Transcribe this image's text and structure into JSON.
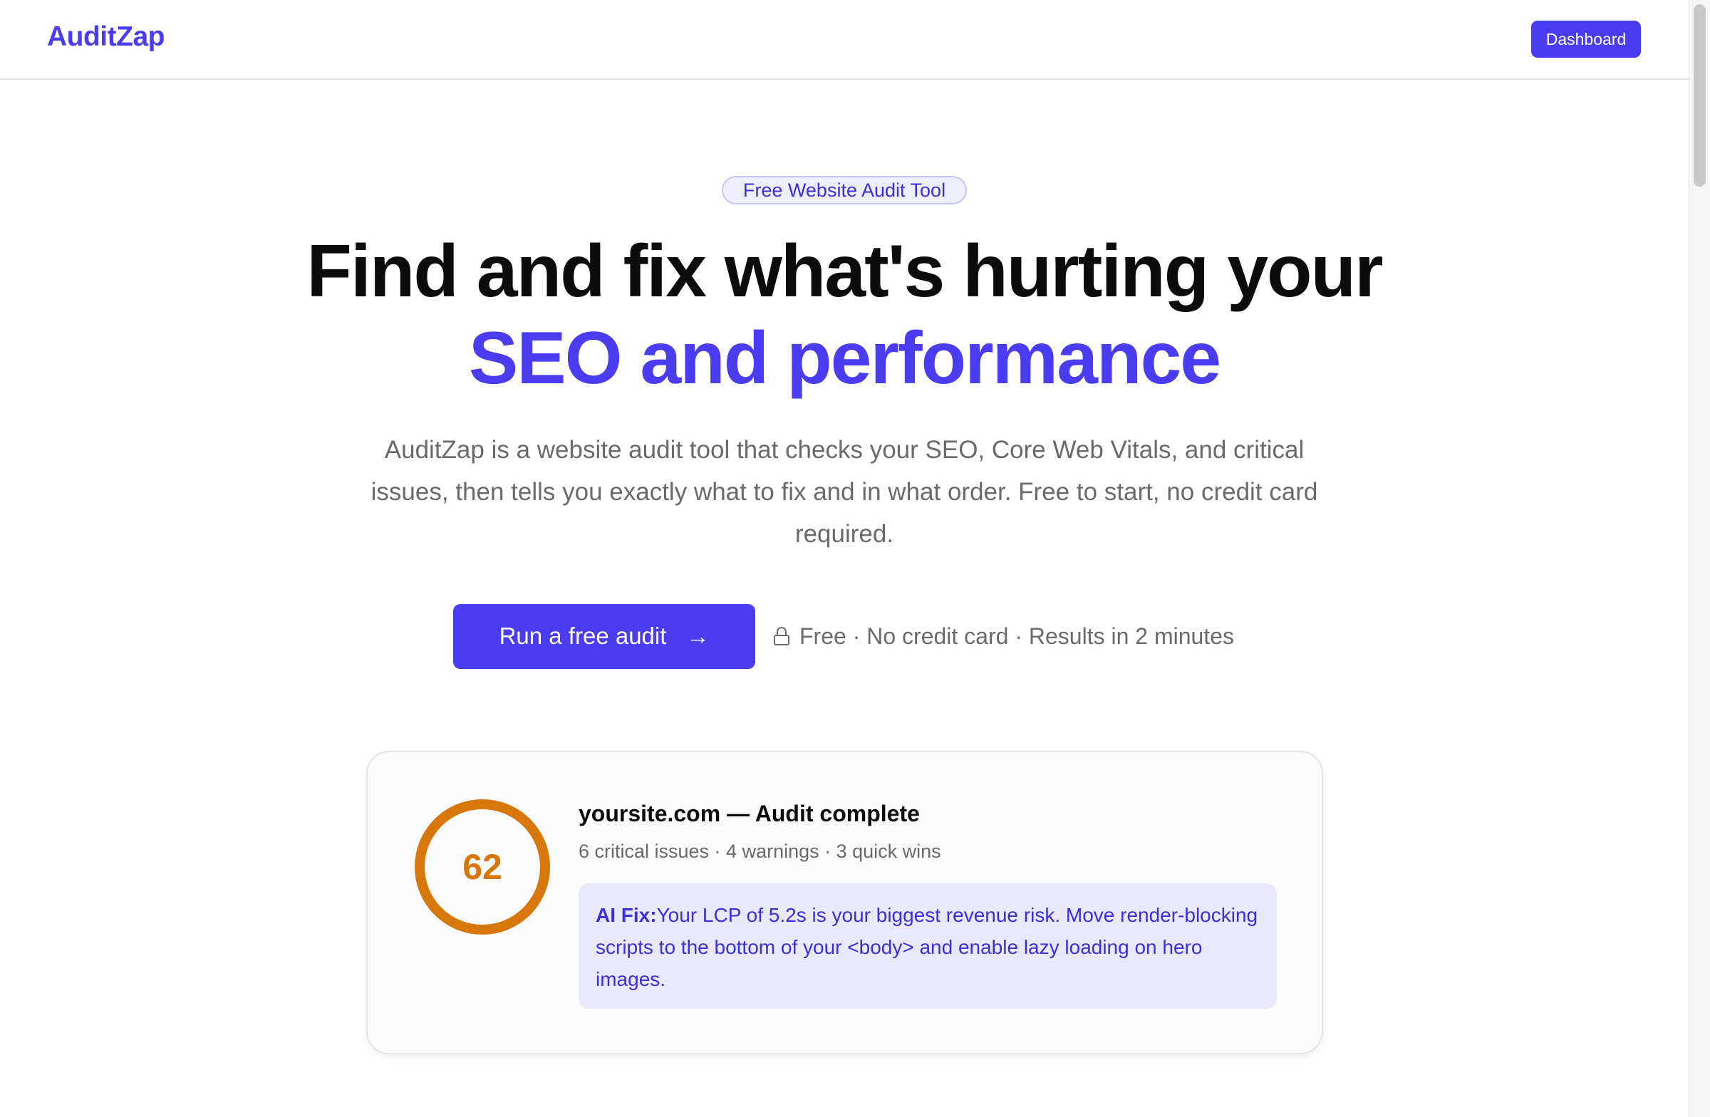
{
  "header": {
    "logo": "AuditZap",
    "dashboard_label": "Dashboard"
  },
  "hero": {
    "badge": "Free Website Audit Tool",
    "headline_line1": "Find and fix what's hurting your",
    "headline_line2": "SEO and performance",
    "subtext": "AuditZap is a website audit tool that checks your SEO, Core Web Vitals, and critical issues, then tells you exactly what to fix and in what order. Free to start, no credit card required.",
    "cta_label": "Run a free audit",
    "cta_icon": "arrow-right-icon",
    "cta_note": "Free · No credit card · Results in 2 minutes",
    "note_icon": "lock-icon"
  },
  "audit_card": {
    "score": "62",
    "score_level": 0.62,
    "title": "yoursite.com — Audit complete",
    "meta": "6 critical issues · 4 warnings · 3 quick wins",
    "ai_label": "AI Fix:",
    "ai_text": "Your LCP of 5.2s is your biggest revenue risk. Move render-blocking scripts to the bottom of your <body> and enable lazy loading on hero images."
  },
  "colors": {
    "brand": "#4a3cf0",
    "score_ring": "#d7770a",
    "ai_box_bg": "#eae8fc"
  }
}
